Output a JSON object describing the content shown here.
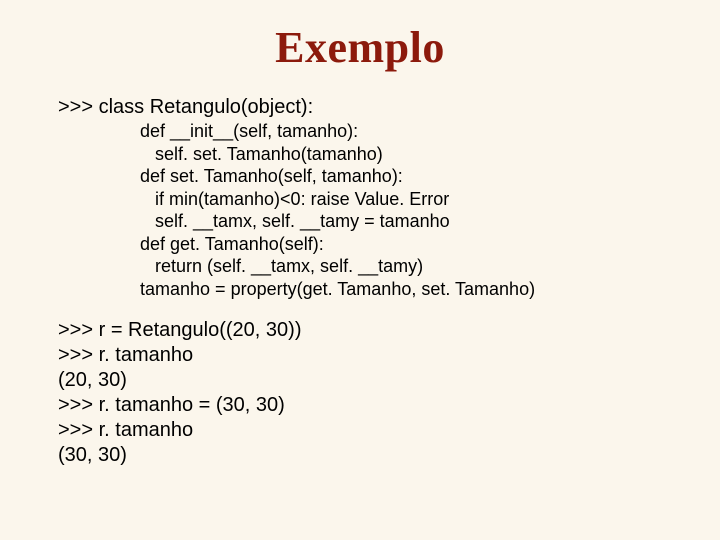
{
  "title": "Exemplo",
  "code": {
    "l01": ">>> class Retangulo(object):",
    "l02": "def __init__(self, tamanho):",
    "l03": "   self. set. Tamanho(tamanho)",
    "l04": "def set. Tamanho(self, tamanho):",
    "l05": "   if min(tamanho)<0: raise Value. Error",
    "l06": "   self. __tamx, self. __tamy = tamanho",
    "l07": "def get. Tamanho(self):",
    "l08": "   return (self. __tamx, self. __tamy)",
    "l09": "tamanho = property(get. Tamanho, set. Tamanho)",
    "l10": ">>> r = Retangulo((20, 30))",
    "l11": ">>> r. tamanho",
    "l12": "(20, 30)",
    "l13": ">>> r. tamanho = (30, 30)",
    "l14": ">>> r. tamanho",
    "l15": "(30, 30)"
  }
}
